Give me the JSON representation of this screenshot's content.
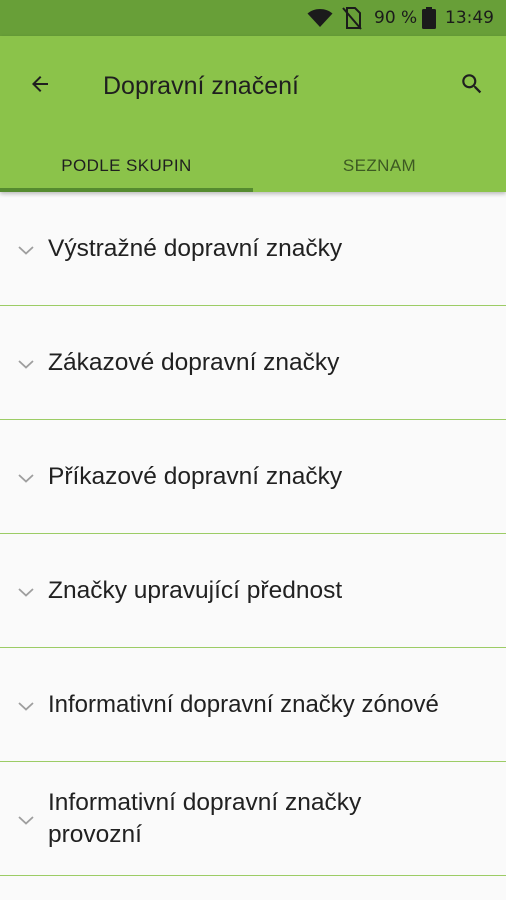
{
  "status_bar": {
    "battery_percent": "90 %",
    "time": "13:49",
    "icons": [
      "wifi-icon",
      "no-sim-icon",
      "battery-icon"
    ]
  },
  "app_bar": {
    "title": "Dopravní značení",
    "back_icon": "arrow-left-icon",
    "search_icon": "search-icon"
  },
  "tabs": [
    {
      "label": "PODLE SKUPIN",
      "active": true
    },
    {
      "label": "SEZNAM",
      "active": false
    }
  ],
  "list": {
    "items": [
      {
        "label": "Výstražné dopravní značky"
      },
      {
        "label": "Zákazové dopravní značky"
      },
      {
        "label": "Příkazové dopravní značky"
      },
      {
        "label": "Značky upravující přednost"
      },
      {
        "label": "Informativní dopravní značky zónové"
      },
      {
        "label": "Informativní dopravní značky provozní"
      }
    ]
  },
  "colors": {
    "status_bar": "#689f38",
    "app_bar": "#8bc34a",
    "tab_indicator": "#558b2f",
    "divider": "#9ccc65"
  }
}
